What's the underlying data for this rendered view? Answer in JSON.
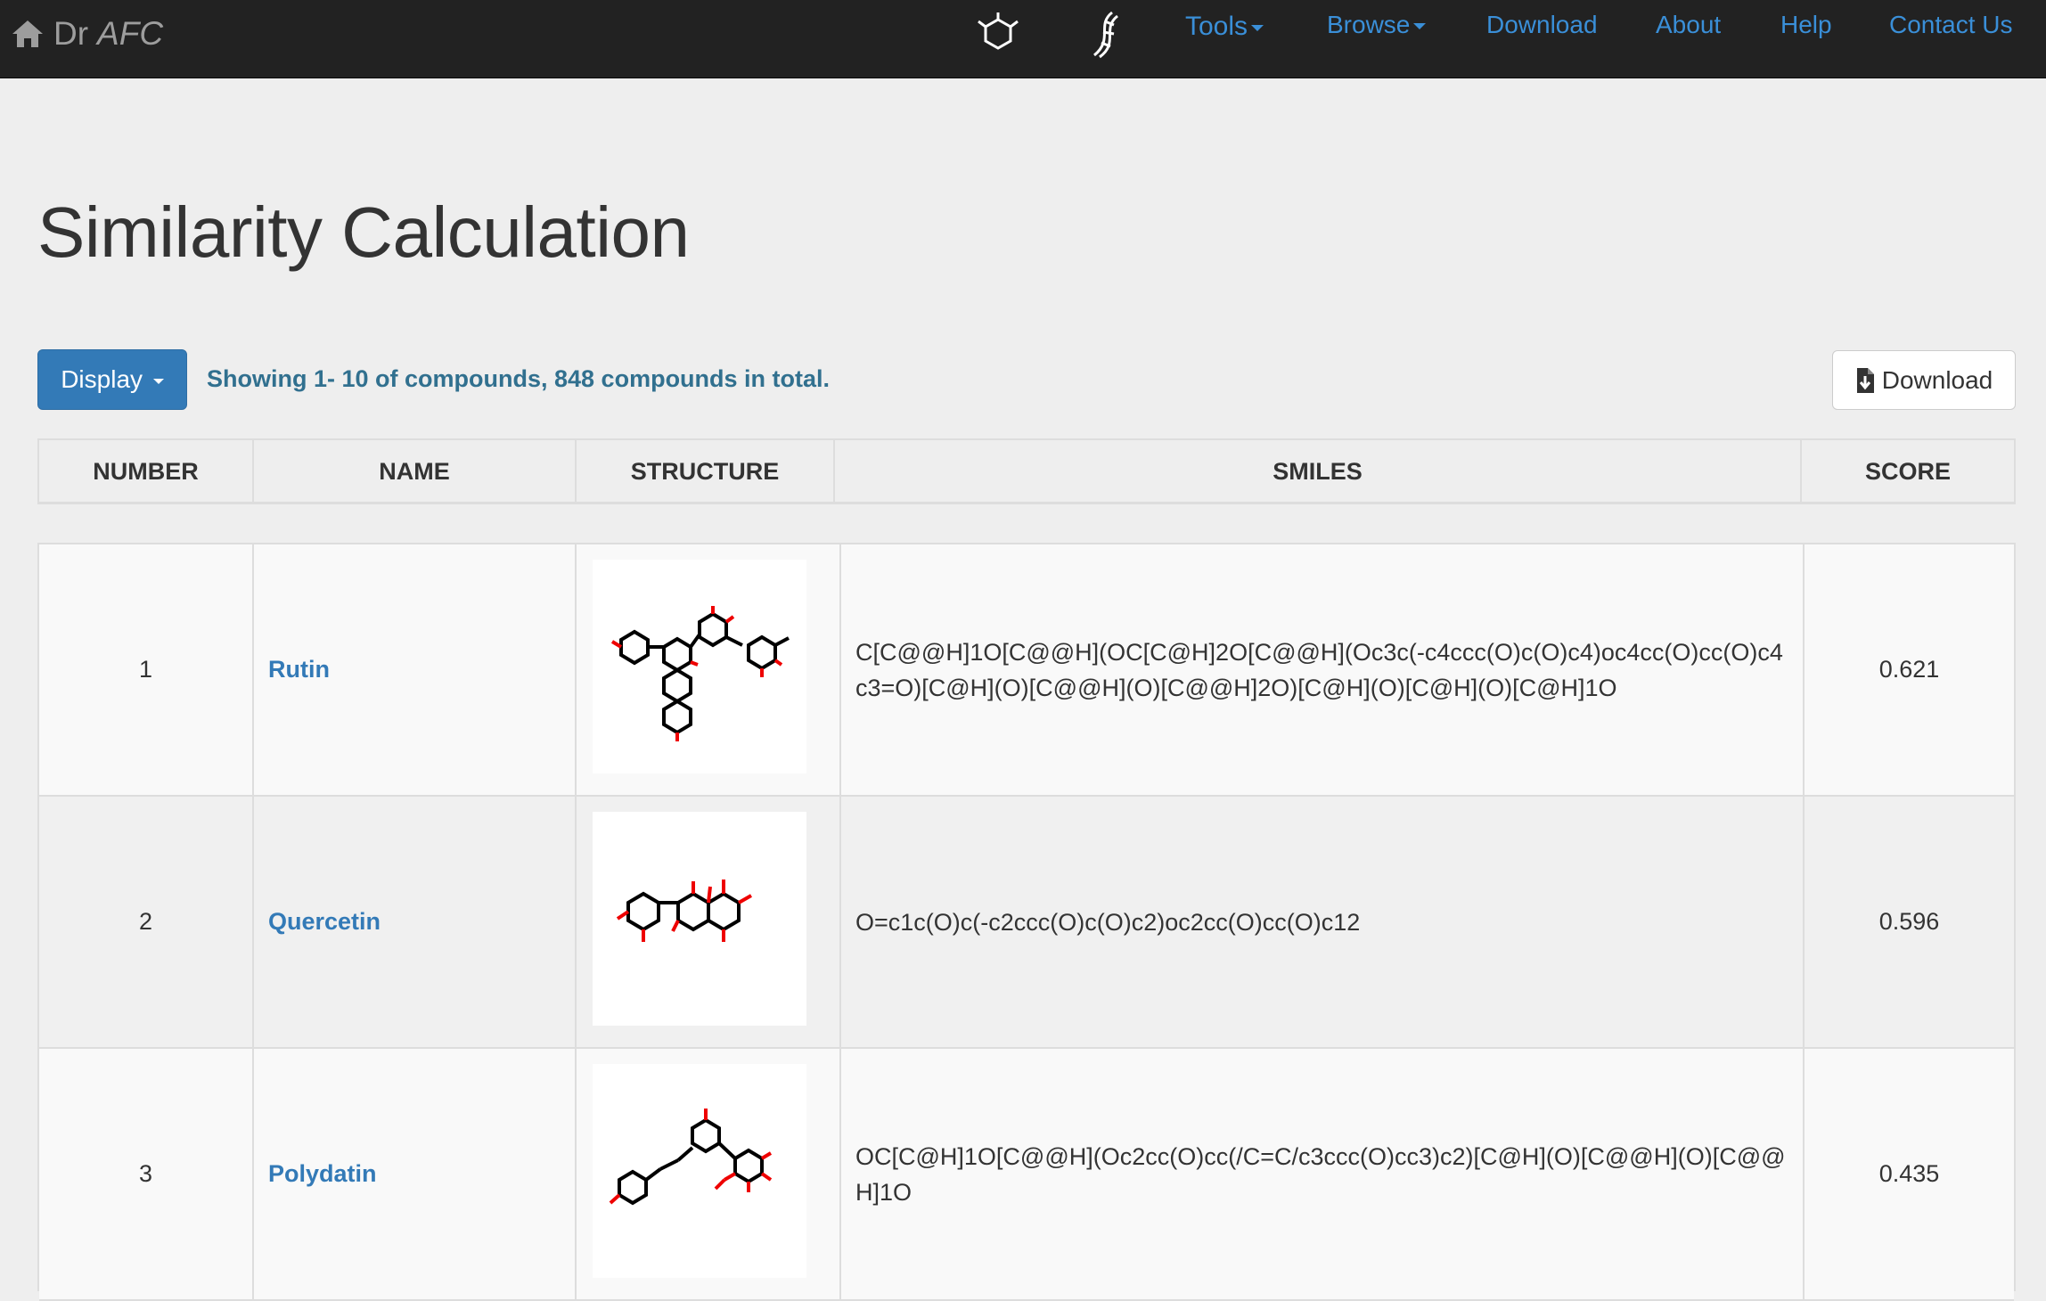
{
  "navbar": {
    "brand_prefix": "Dr",
    "brand_name": "AFC",
    "links": {
      "tools": "Tools",
      "browse": "Browse",
      "download": "Download",
      "about": "About",
      "help": "Help",
      "contact": "Contact Us"
    },
    "link_color": "#3a8fd8",
    "background": "#222222"
  },
  "page": {
    "title": "Similarity Calculation",
    "display_button": "Display",
    "showing_text": "Showing 1- 10 of compounds, 848 compounds in total.",
    "download_button": "Download"
  },
  "table": {
    "headers": [
      "NUMBER",
      "NAME",
      "STRUCTURE",
      "SMILES",
      "SCORE"
    ],
    "rows": [
      {
        "number": "1",
        "name": "Rutin",
        "smiles": "C[C@@H]1O[C@@H](OC[C@H]2O[C@@H](Oc3c(-c4ccc(O)c(O)c4)oc4cc(O)cc(O)c4c3=O)[C@H](O)[C@@H](O)[C@@H]2O)[C@H](O)[C@H](O)[C@H]1O",
        "score": "0.621"
      },
      {
        "number": "2",
        "name": "Quercetin",
        "smiles": "O=c1c(O)c(-c2ccc(O)c(O)c2)oc2cc(O)cc(O)c12",
        "score": "0.596"
      },
      {
        "number": "3",
        "name": "Polydatin",
        "smiles": "OC[C@H]1O[C@@H](Oc2cc(O)cc(/C=C/c3ccc(O)cc3)c2)[C@H](O)[C@@H](O)[C@@H]1O",
        "score": "0.435"
      }
    ]
  }
}
